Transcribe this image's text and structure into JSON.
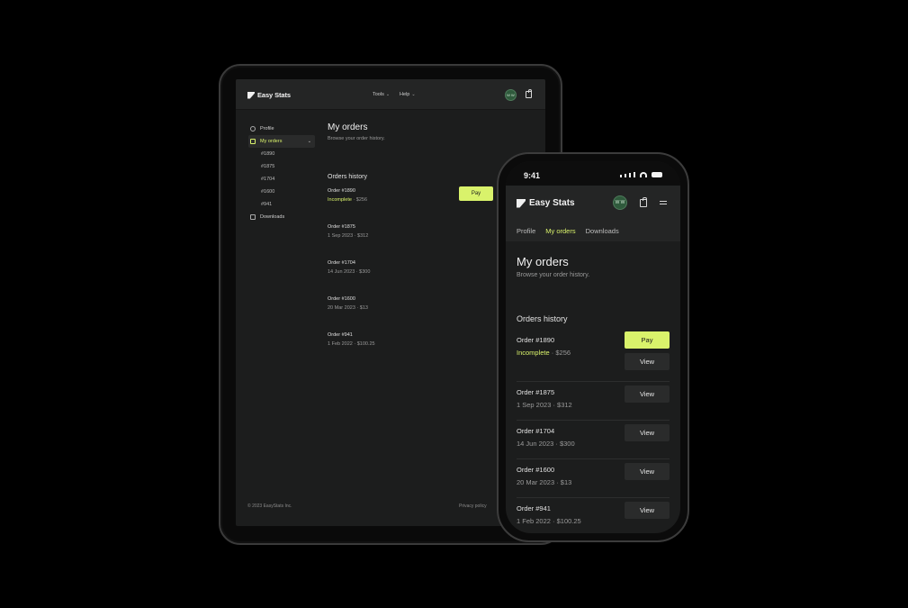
{
  "brand": {
    "name": "Easy Stats",
    "avatar_initials": "W W"
  },
  "colors": {
    "accent": "#d9f26b",
    "background": "#1c1d1d",
    "header": "#242525"
  },
  "tablet": {
    "nav": {
      "tools": "Tools",
      "help": "Help"
    },
    "sidebar": {
      "profile": "Profile",
      "my_orders": "My orders",
      "orders": [
        "#1890",
        "#1875",
        "#1704",
        "#1600",
        "#941"
      ],
      "downloads": "Downloads"
    },
    "page_title": "My orders",
    "page_subtitle": "Browse your order history.",
    "section_title": "Orders history",
    "orders": [
      {
        "title": "Order #1890",
        "status": "Incomplete",
        "meta": " · $256"
      },
      {
        "title": "Order #1875",
        "meta": "1 Sep 2023 · $312"
      },
      {
        "title": "Order #1704",
        "meta": "14 Jun 2023 · $300"
      },
      {
        "title": "Order #1600",
        "meta": "20 Mar 2023 · $13"
      },
      {
        "title": "Order #941",
        "meta": "1 Feb 2022 · $100.25"
      }
    ],
    "pay_label": "Pay",
    "footer": {
      "copyright": "© 2023 EasyStats Inc.",
      "privacy": "Privacy policy"
    }
  },
  "phone": {
    "time": "9:41",
    "tabs": {
      "profile": "Profile",
      "my_orders": "My orders",
      "downloads": "Downloads"
    },
    "page_title": "My orders",
    "page_subtitle": "Browse your order history.",
    "section_title": "Orders history",
    "orders": [
      {
        "title": "Order #1890",
        "status": "Incomplete",
        "meta": " · $256"
      },
      {
        "title": "Order #1875",
        "meta": "1 Sep 2023 · $312"
      },
      {
        "title": "Order #1704",
        "meta": "14 Jun 2023 · $300"
      },
      {
        "title": "Order #1600",
        "meta": "20 Mar 2023 · $13"
      },
      {
        "title": "Order #941",
        "meta": "1 Feb 2022 · $100.25"
      }
    ],
    "pay_label": "Pay",
    "view_label": "View"
  }
}
